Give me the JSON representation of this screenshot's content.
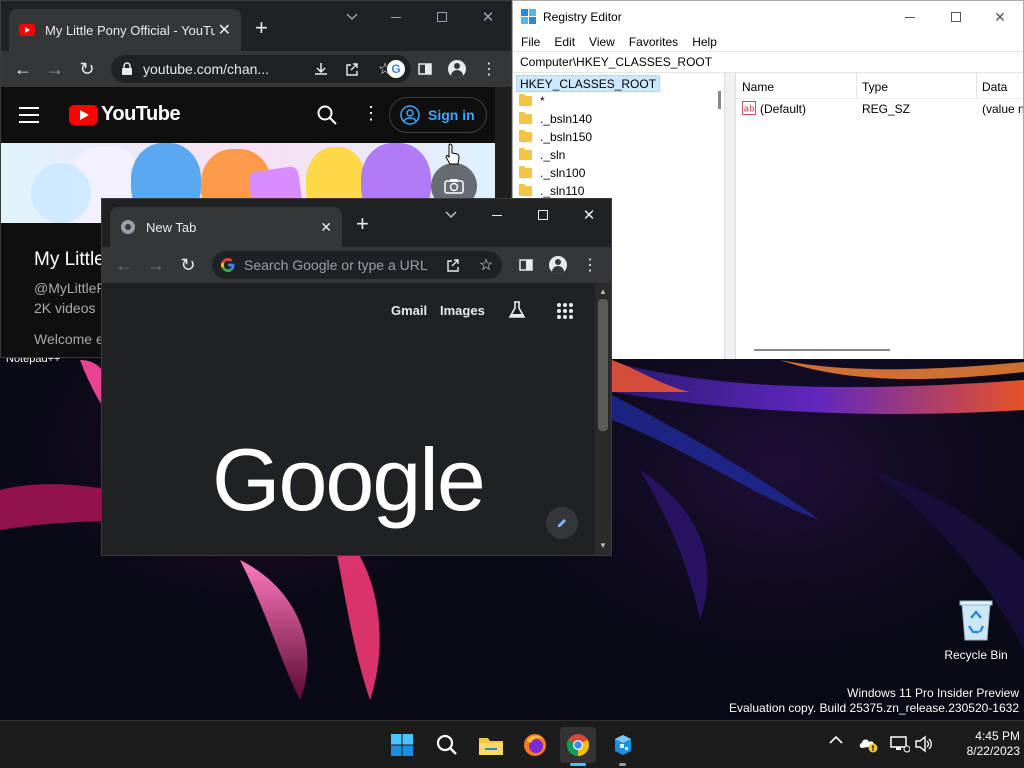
{
  "desktop": {
    "recycle_bin_label": "Recycle Bin",
    "watermark_line1": "Windows 11 Pro Insider Preview",
    "watermark_line2": "Evaluation copy. Build 25375.zn_release.230520-1632",
    "hidden_label": "Notepad++"
  },
  "youtube_window": {
    "tab_title": "My Little Pony Official - YouTub",
    "address": "youtube.com/chan...",
    "brand": "YouTube",
    "sign_in_label": "Sign in",
    "channel_name": "My Little",
    "channel_handle": "@MyLittleP",
    "video_count": "2K videos",
    "description_start": "Welcome e"
  },
  "registry_editor": {
    "title": "Registry Editor",
    "menu": [
      "File",
      "Edit",
      "View",
      "Favorites",
      "Help"
    ],
    "address": "Computer\\HKEY_CLASSES_ROOT",
    "tree_root": "HKEY_CLASSES_ROOT",
    "tree_items": [
      "*",
      "._bsln140",
      "._bsln150",
      "._sln",
      "._sln100",
      "._sln110"
    ],
    "columns": [
      "Name",
      "Type",
      "Data"
    ],
    "values": [
      {
        "name": "(Default)",
        "type": "REG_SZ",
        "data": "(value n"
      }
    ]
  },
  "newtab_window": {
    "tab_title": "New Tab",
    "omnibox_placeholder": "Search Google or type a URL",
    "gmail_label": "Gmail",
    "images_label": "Images",
    "logo_text": "Google"
  },
  "taskbar": {
    "time": "4:45 PM",
    "date": "8/22/2023",
    "pinned": [
      "start-icon",
      "search-icon",
      "file-explorer-icon",
      "firefox-icon",
      "chrome-icon",
      "registry-editor-icon"
    ]
  },
  "colors": {
    "youtube_red": "#ff0000",
    "signin_blue": "#3ea6ff",
    "chrome_dark": "#202124",
    "toolbar_dark": "#35363a",
    "registry_select": "#cce8ff"
  }
}
